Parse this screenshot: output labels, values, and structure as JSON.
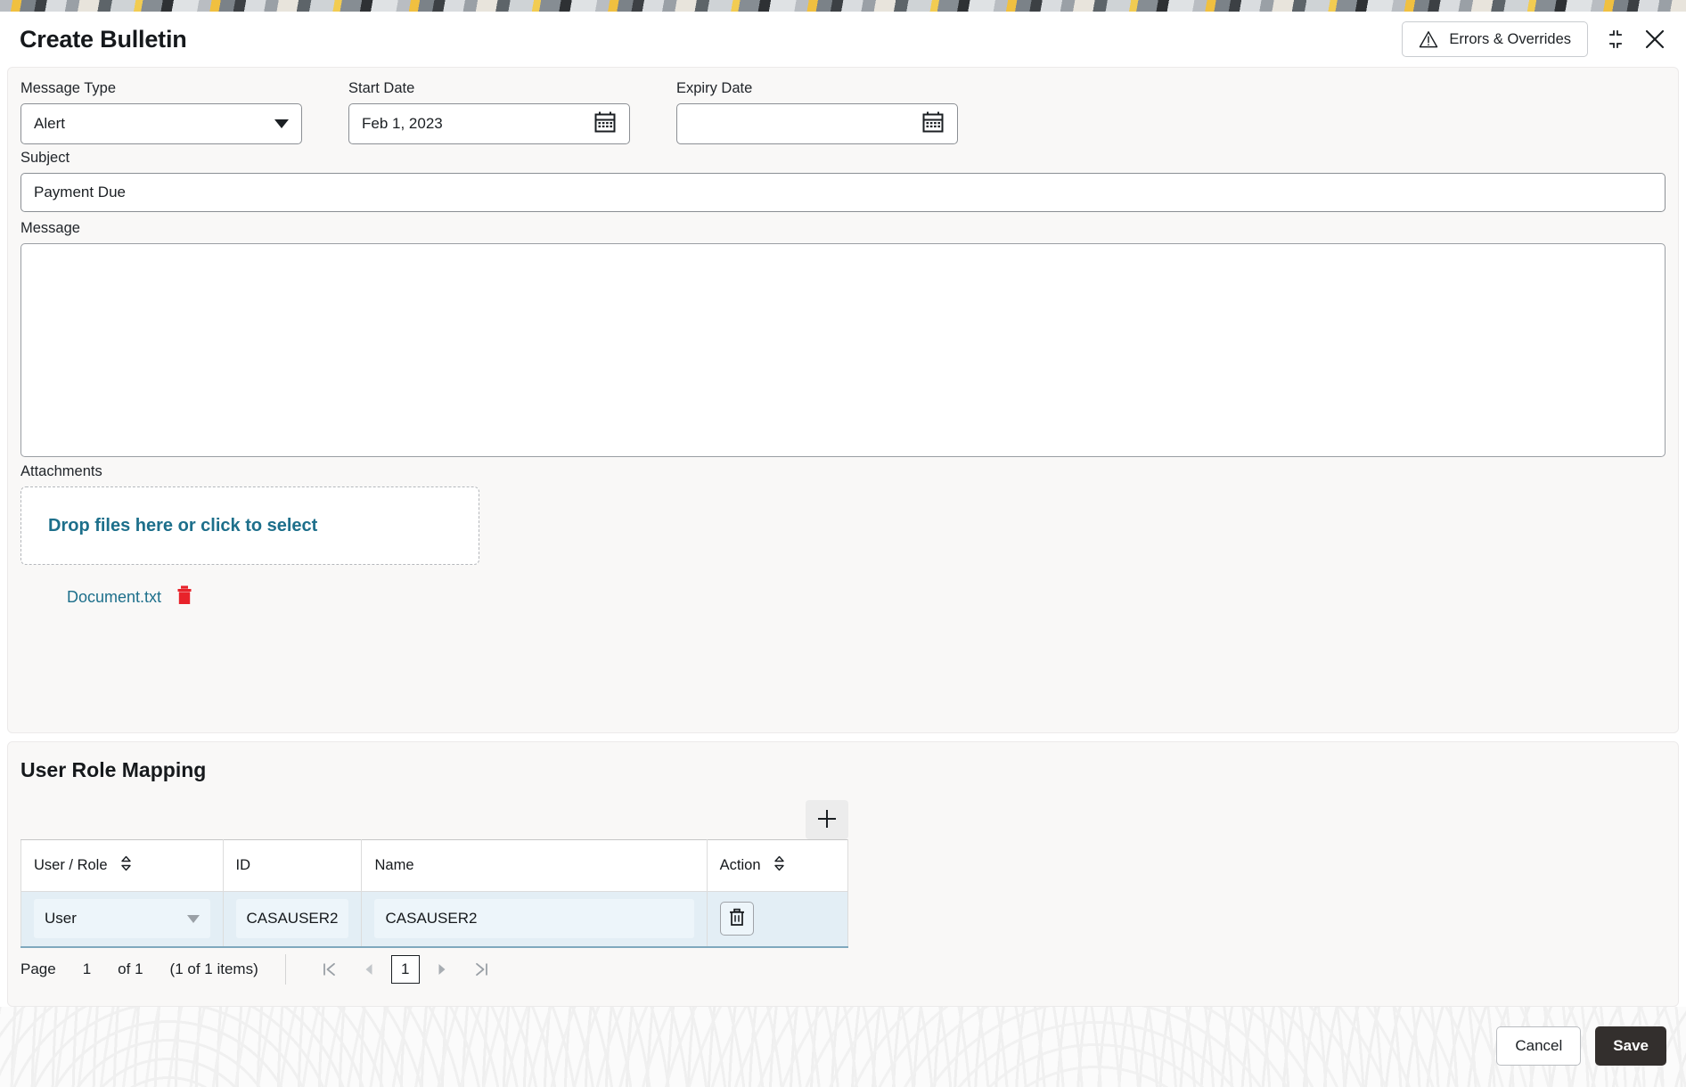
{
  "header": {
    "title": "Create Bulletin",
    "errors_button": "Errors & Overrides",
    "restore_icon": "restore-down-icon",
    "close_icon": "close-icon",
    "warning_icon": "warning-triangle-icon"
  },
  "form": {
    "message_type": {
      "label": "Message Type",
      "value": "Alert"
    },
    "start_date": {
      "label": "Start Date",
      "value": "Feb 1, 2023",
      "icon": "calendar-icon"
    },
    "expiry_date": {
      "label": "Expiry Date",
      "value": "",
      "icon": "calendar-icon"
    },
    "subject": {
      "label": "Subject",
      "value": "Payment Due"
    },
    "message": {
      "label": "Message",
      "value": ""
    },
    "attachments": {
      "label": "Attachments",
      "dropzone_text": "Drop files here or click to select",
      "files": [
        {
          "name": "Document.txt",
          "delete_icon": "trash-icon"
        }
      ]
    }
  },
  "user_role_mapping": {
    "title": "User Role Mapping",
    "add_icon": "plus-icon",
    "columns": [
      "User / Role",
      "ID",
      "Name",
      "Action"
    ],
    "rows": [
      {
        "user_role": "User",
        "id": "CASAUSER2",
        "name": "CASAUSER2",
        "action_icon": "trash-icon"
      }
    ],
    "pagination": {
      "page_label": "Page",
      "page_number": "1",
      "of_label": "of 1",
      "items_label": "(1 of 1 items)",
      "current_page": "1",
      "first_icon": "first-page-icon",
      "prev_icon": "previous-page-icon",
      "next_icon": "next-page-icon",
      "last_icon": "last-page-icon"
    }
  },
  "footer": {
    "cancel_label": "Cancel",
    "save_label": "Save"
  },
  "colors": {
    "link": "#1d6f8b",
    "row_selected": "#e3eef5",
    "save_bg": "#332f2d",
    "delete_red": "#e8222a"
  }
}
